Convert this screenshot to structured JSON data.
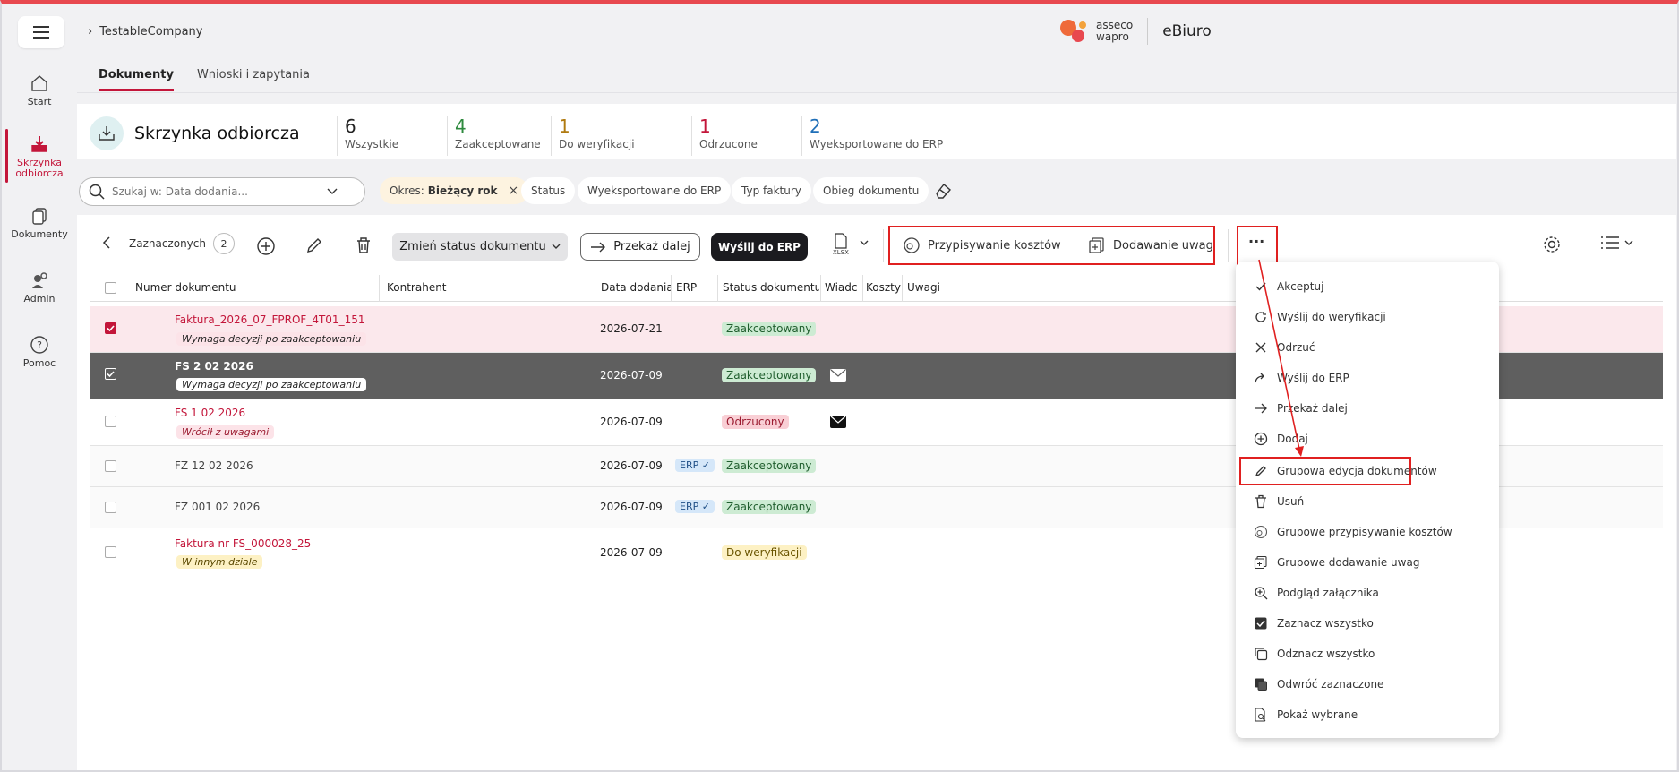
{
  "topbar": {
    "breadcrumb_company": "TestableCompany",
    "logo_line1": "asseco",
    "logo_line2": "wapro",
    "app_name": "eBiuro"
  },
  "nav": {
    "start": "Start",
    "inbox_line1": "Skrzynka",
    "inbox_line2": "odbiorcza",
    "documents": "Dokumenty",
    "admin": "Admin",
    "help": "Pomoc"
  },
  "tabs": {
    "documents": "Dokumenty",
    "requests": "Wnioski i zapytania"
  },
  "header": {
    "title": "Skrzynka odbiorcza",
    "stats": [
      {
        "num": "6",
        "label": "Wszystkie",
        "color": "#222222"
      },
      {
        "num": "4",
        "label": "Zaakceptowane",
        "color": "#2e8a3e"
      },
      {
        "num": "1",
        "label": "Do weryfikacji",
        "color": "#b07a10"
      },
      {
        "num": "1",
        "label": "Odrzucone",
        "color": "#c3163a"
      },
      {
        "num": "2",
        "label": "Wyeksportowane do ERP",
        "color": "#1f6fb8"
      }
    ]
  },
  "filters": {
    "search_placeholder": "Szukaj w: Data dodania...",
    "period_label": "Okres:",
    "period_value": "Bieżący rok",
    "status": "Status",
    "exported": "Wyeksportowane do ERP",
    "invoice_type": "Typ faktury",
    "flow": "Obieg dokumentu"
  },
  "toolbar": {
    "selected_label": "Zaznaczonych",
    "selected_count": "2",
    "change_status": "Zmień status dokumentu",
    "forward": "Przekaż dalej",
    "send_erp": "Wyślij do ERP",
    "xlsx": "XLSX",
    "assign_costs": "Przypisywanie kosztów",
    "add_notes": "Dodawanie uwag",
    "more": "···"
  },
  "table": {
    "headers": {
      "number": "Numer dokumentu",
      "contractor": "Kontrahent",
      "date": "Data dodania",
      "erp": "ERP",
      "status": "Status dokumentu",
      "messages": "Wiadc",
      "costs": "Koszty",
      "notes": "Uwagi"
    },
    "rows": [
      {
        "name": "Faktura_2026_07_FPROF_4T01_151",
        "tag": "Wymaga decyzji po zaakceptowaniu",
        "date": "2026-07-21",
        "erp": "",
        "status": "Zaakceptowany"
      },
      {
        "name": "FS 2 02 2026",
        "tag": "Wymaga decyzji po zaakceptowaniu",
        "date": "2026-07-09",
        "erp": "",
        "status": "Zaakceptowany"
      },
      {
        "name": "FS 1 02 2026",
        "tag": "Wrócił z uwagami",
        "date": "2026-07-09",
        "erp": "",
        "status": "Odrzucony"
      },
      {
        "name": "FZ 12 02 2026",
        "tag": "",
        "date": "2026-07-09",
        "erp": "ERP ✓",
        "status": "Zaakceptowany"
      },
      {
        "name": "FZ 001 02 2026",
        "tag": "",
        "date": "2026-07-09",
        "erp": "ERP ✓",
        "status": "Zaakceptowany"
      },
      {
        "name": "Faktura nr FS_000028_25",
        "tag": "W innym dziale",
        "date": "2026-07-09",
        "erp": "",
        "status": "Do weryfikacji"
      }
    ]
  },
  "menu": {
    "items": [
      "Akceptuj",
      "Wyślij do weryfikacji",
      "Odrzuć",
      "Wyślij do ERP",
      "Przekaż dalej",
      "Dodaj",
      "Grupowa edycja dokumentów",
      "Usuń",
      "Grupowe przypisywanie kosztów",
      "Grupowe dodawanie uwag",
      "Podgląd załącznika",
      "Zaznacz wszystko",
      "Odznacz wszystko",
      "Odwróć zaznaczone",
      "Pokaż wybrane"
    ]
  },
  "colors": {
    "accent": "#c3163a",
    "highlight_box": "#e02020"
  }
}
